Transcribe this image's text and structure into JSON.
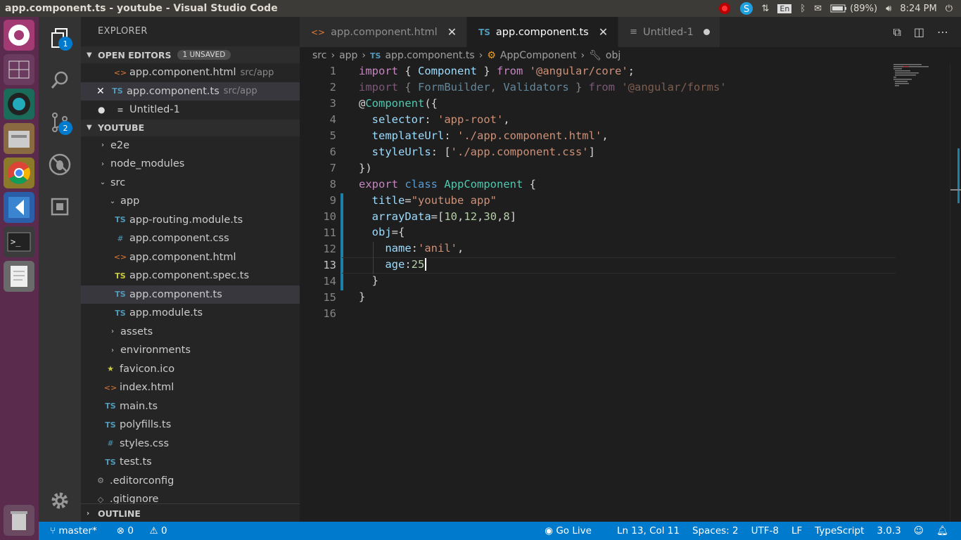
{
  "window": {
    "title": "app.component.ts - youtube - Visual Studio Code"
  },
  "tray": {
    "lang": "En",
    "battery": "(89%)",
    "time": "8:24 PM"
  },
  "explorer": {
    "header": "EXPLORER",
    "open_editors": {
      "label": "OPEN EDITORS",
      "badge": "1 UNSAVED",
      "items": [
        {
          "icon": "<>",
          "name": "app.component.html",
          "desc": "src/app"
        },
        {
          "icon": "TS",
          "name": "app.component.ts",
          "desc": "src/app"
        },
        {
          "icon": "≡",
          "name": "Untitled-1",
          "desc": ""
        }
      ]
    },
    "project": {
      "label": "YOUTUBE",
      "items": [
        {
          "twisty": "›",
          "icon": "",
          "name": "e2e"
        },
        {
          "twisty": "›",
          "icon": "",
          "name": "node_modules"
        },
        {
          "twisty": "⌄",
          "icon": "",
          "name": "src"
        },
        {
          "twisty": "⌄",
          "icon": "",
          "name": "app"
        },
        {
          "twisty": "",
          "icon": "TS",
          "name": "app-routing.module.ts"
        },
        {
          "twisty": "",
          "icon": "#",
          "name": "app.component.css"
        },
        {
          "twisty": "",
          "icon": "<>",
          "name": "app.component.html"
        },
        {
          "twisty": "",
          "icon": "TS",
          "name": "app.component.spec.ts"
        },
        {
          "twisty": "",
          "icon": "TS",
          "name": "app.component.ts"
        },
        {
          "twisty": "",
          "icon": "TS",
          "name": "app.module.ts"
        },
        {
          "twisty": "›",
          "icon": "",
          "name": "assets"
        },
        {
          "twisty": "›",
          "icon": "",
          "name": "environments"
        },
        {
          "twisty": "",
          "icon": "★",
          "name": "favicon.ico"
        },
        {
          "twisty": "",
          "icon": "<>",
          "name": "index.html"
        },
        {
          "twisty": "",
          "icon": "TS",
          "name": "main.ts"
        },
        {
          "twisty": "",
          "icon": "TS",
          "name": "polyfills.ts"
        },
        {
          "twisty": "",
          "icon": "#",
          "name": "styles.css"
        },
        {
          "twisty": "",
          "icon": "TS",
          "name": "test.ts"
        },
        {
          "twisty": "",
          "icon": "⚙",
          "name": ".editorconfig"
        },
        {
          "twisty": "",
          "icon": "◇",
          "name": ".gitignore"
        }
      ]
    },
    "outline": "OUTLINE"
  },
  "activity": {
    "explorer_badge": "1",
    "scm_badge": "2"
  },
  "tabs": [
    {
      "icon": "<>",
      "label": "app.component.html",
      "state": "close"
    },
    {
      "icon": "TS",
      "label": "app.component.ts",
      "state": "close"
    },
    {
      "icon": "≡",
      "label": "Untitled-1",
      "state": "dirty"
    }
  ],
  "breadcrumb": [
    "src",
    "app",
    "app.component.ts",
    "AppComponent",
    "obj"
  ],
  "code": {
    "line_numbers": [
      "1",
      "2",
      "3",
      "4",
      "5",
      "6",
      "7",
      "8",
      "9",
      "10",
      "11",
      "12",
      "13",
      "14",
      "15",
      "16"
    ],
    "cursor": "Ln 13, Col 11"
  },
  "status": {
    "branch": "master*",
    "errors": "0",
    "warnings": "0",
    "go_live": "Go Live",
    "position": "Ln 13, Col 11",
    "spaces": "Spaces: 2",
    "encoding": "UTF-8",
    "eol": "LF",
    "language": "TypeScript",
    "version": "3.0.3"
  }
}
